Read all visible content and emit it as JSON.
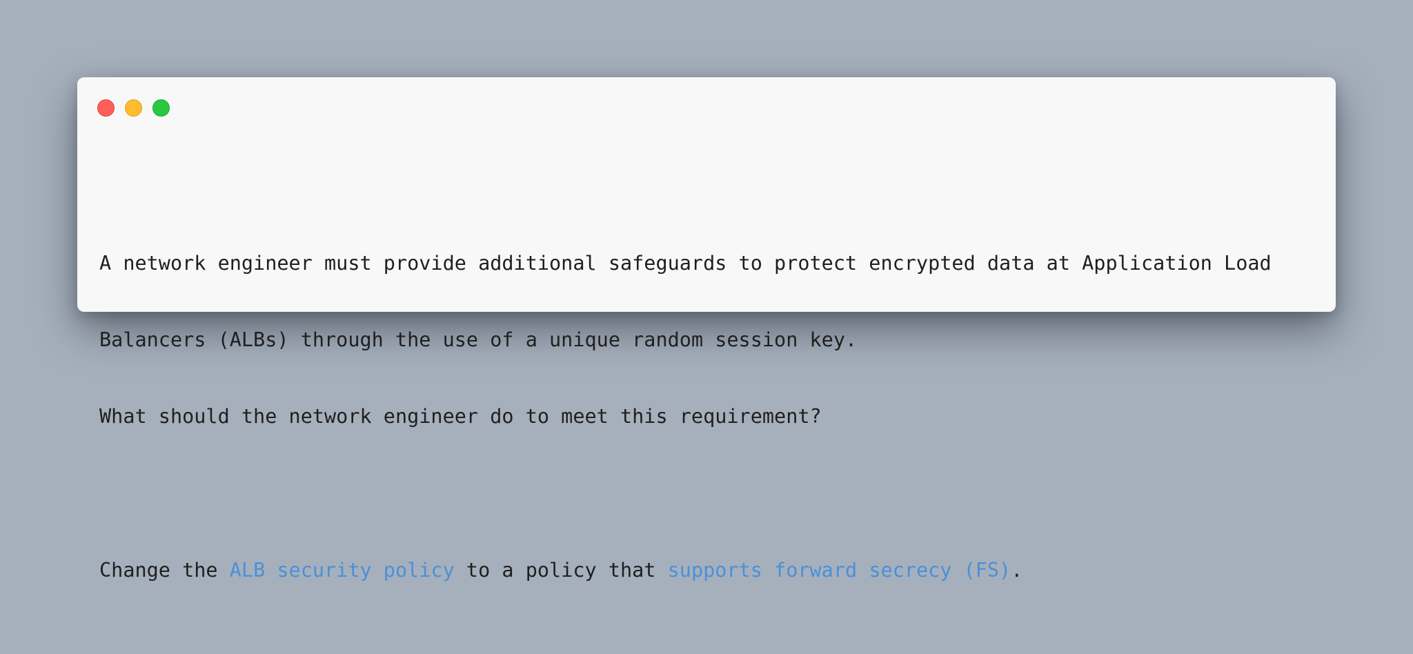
{
  "window": {
    "controls": {
      "close_color": "#ff5f57",
      "minimize_color": "#febc2e",
      "maximize_color": "#28c840"
    }
  },
  "question": {
    "line1": "A network engineer must provide additional safeguards to protect encrypted data at Application Load",
    "line2": "Balancers (ALBs) through the use of a unique random session key.",
    "line3": "What should the network engineer do to meet this requirement?"
  },
  "answer": {
    "part1": "Change the ",
    "highlight1": "ALB security policy",
    "part2": " to a policy that ",
    "highlight2": "supports forward secrecy (FS)",
    "part3": "."
  },
  "colors": {
    "highlight": "#4a90d9",
    "text": "#1f1f1f",
    "background": "#a6b0bc",
    "window": "#f8f8f8"
  }
}
